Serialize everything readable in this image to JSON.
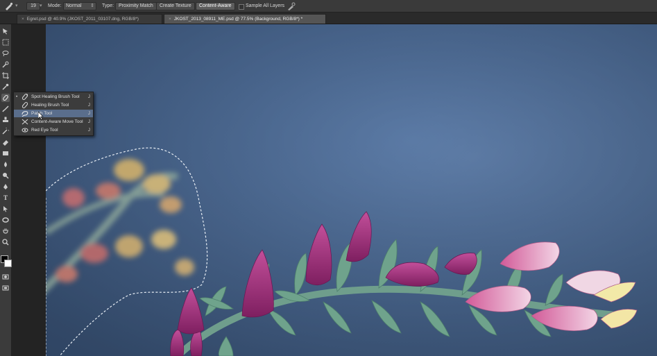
{
  "options_bar": {
    "brush_size": "19",
    "mode_label": "Mode:",
    "mode_value": "Normal",
    "type_label": "Type:",
    "type_buttons": [
      "Proximity Match",
      "Create Texture",
      "Content-Aware"
    ],
    "selected_type": "Content-Aware",
    "sample_all_layers_label": "Sample All Layers",
    "sample_all_layers_checked": false
  },
  "tabs": [
    {
      "label": "Egret.psd @ 40.9% (JKOST_2011_03107.dng, RGB/8*)",
      "active": false
    },
    {
      "label": "JKOST_2013_08911_ME.psd @ 77.5% (Background, RGB/8*) *",
      "active": true
    }
  ],
  "tools_icons": [
    "move-icon",
    "marquee-icon",
    "lasso-icon",
    "quick-select-icon",
    "crop-icon",
    "eyedropper-icon",
    "healing-brush-icon",
    "brush-icon",
    "clone-stamp-icon",
    "history-brush-icon",
    "eraser-icon",
    "gradient-icon",
    "blur-icon",
    "dodge-icon",
    "pen-icon",
    "type-icon",
    "path-select-icon",
    "shape-icon",
    "hand-icon",
    "zoom-icon",
    "color-swatches-icon",
    "quick-mask-icon",
    "screen-mode-icon"
  ],
  "flyout_menu": {
    "items": [
      {
        "label": "Spot Healing Brush Tool",
        "shortcut": "J",
        "current": true,
        "icon": "spot-healing-icon"
      },
      {
        "label": "Healing Brush Tool",
        "shortcut": "J",
        "current": false,
        "icon": "healing-brush-icon"
      },
      {
        "label": "Patch Tool",
        "shortcut": "J",
        "current": false,
        "icon": "patch-icon",
        "highlighted": true
      },
      {
        "label": "Content-Aware Move Tool",
        "shortcut": "J",
        "current": false,
        "icon": "content-aware-move-icon"
      },
      {
        "label": "Red Eye Tool",
        "shortcut": "J",
        "current": false,
        "icon": "red-eye-icon"
      }
    ]
  },
  "colors": {
    "canvas_bg": "#4f6e99",
    "menu_highlight": "#5a6e8c",
    "flower_magenta": "#a8327d",
    "flower_pink": "#e07ab0",
    "stem_green": "#6f9e8c"
  }
}
